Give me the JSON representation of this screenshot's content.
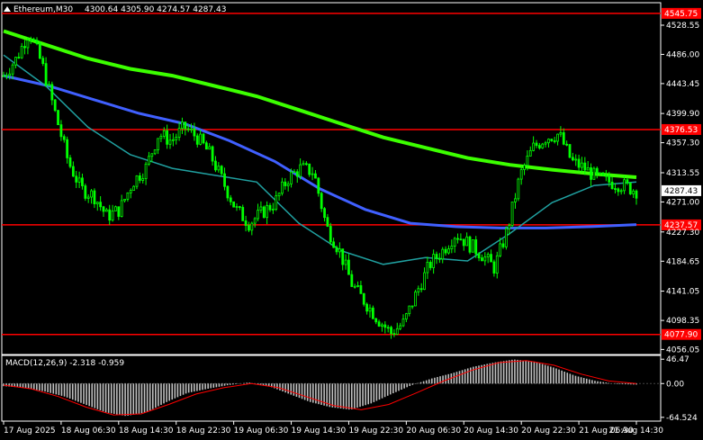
{
  "header": {
    "symbol_label": "Ethereum,M30",
    "ohlc_label": "4300.64 4305.90 4274.57 4287.43"
  },
  "macd_label": "MACD(12,26,9) -2.318 -0.959",
  "colors": {
    "background": "#000000",
    "candle": "#00ff00",
    "ma_fast": "#20a0a0",
    "ma_mid": "#3cff00",
    "ma_slow": "#4060ff",
    "level_line": "#ff0000",
    "level_label_bg": "#ff0000",
    "current_price_bg": "#ffffff",
    "macd_hist": "#c0c0c0",
    "macd_signal": "#ff0000",
    "grid": "#ffffff"
  },
  "chart_data": {
    "type": "candlestick",
    "price_axis": {
      "range": [
        4050,
        4560
      ],
      "ticks": [
        "4528.55",
        "4486.00",
        "4443.45",
        "4399.90",
        "4357.30",
        "4313.55",
        "4271.00",
        "4227.30",
        "4184.65",
        "4141.05",
        "4098.35",
        "4056.05"
      ]
    },
    "horizontal_levels": [
      {
        "label": "4545.75",
        "value": 4545.75
      },
      {
        "label": "4376.53",
        "value": 4376.53
      },
      {
        "label": "4237.57",
        "value": 4237.57
      },
      {
        "label": "4077.90",
        "value": 4077.9
      }
    ],
    "current_price": {
      "label": "4287.43",
      "value": 4287.43
    },
    "time_axis": [
      "17 Aug 2025",
      "18 Aug 06:30",
      "18 Aug 14:30",
      "18 Aug 22:30",
      "19 Aug 06:30",
      "19 Aug 14:30",
      "19 Aug 22:30",
      "20 Aug 06:30",
      "20 Aug 14:30",
      "20 Aug 22:30",
      "21 Aug 06:30",
      "21 Aug 14:30"
    ],
    "close_path": [
      4455,
      4480,
      4520,
      4470,
      4400,
      4330,
      4290,
      4280,
      4250,
      4260,
      4300,
      4320,
      4370,
      4360,
      4380,
      4365,
      4340,
      4300,
      4260,
      4240,
      4255,
      4270,
      4305,
      4320,
      4315,
      4235,
      4200,
      4150,
      4125,
      4100,
      4080,
      4095,
      4140,
      4180,
      4200,
      4225,
      4210,
      4195,
      4175,
      4230,
      4310,
      4350,
      4365,
      4370,
      4330,
      4320,
      4305,
      4300,
      4295,
      4287.43
    ],
    "ma_mid": [
      4520,
      4500,
      4480,
      4465,
      4455,
      4440,
      4425,
      4405,
      4385,
      4365,
      4350,
      4335,
      4325,
      4318,
      4312,
      4307
    ],
    "ma_slow": [
      4455,
      4440,
      4420,
      4400,
      4385,
      4360,
      4330,
      4290,
      4260,
      4240,
      4235,
      4233,
      4233,
      4235,
      4238
    ],
    "ma_fast": [
      4485,
      4440,
      4380,
      4340,
      4320,
      4310,
      4300,
      4240,
      4200,
      4180,
      4190,
      4185,
      4225,
      4270,
      4295,
      4300
    ],
    "macd_axis": {
      "range": [
        -70,
        52
      ],
      "ticks": [
        "46.47",
        "0.00",
        "-64.524"
      ]
    },
    "macd_hist": [
      -5,
      -8,
      -15,
      -25,
      -40,
      -55,
      -62,
      -55,
      -35,
      -18,
      -10,
      -3,
      2,
      -5,
      -20,
      -35,
      -45,
      -50,
      -38,
      -20,
      -3,
      10,
      20,
      32,
      40,
      46,
      42,
      30,
      15,
      5,
      -1,
      -2
    ],
    "macd_signal": [
      -3,
      -10,
      -25,
      -45,
      -60,
      -58,
      -40,
      -20,
      -8,
      0,
      -8,
      -25,
      -42,
      -50,
      -40,
      -18,
      5,
      25,
      40,
      44,
      35,
      18,
      5,
      0
    ]
  }
}
